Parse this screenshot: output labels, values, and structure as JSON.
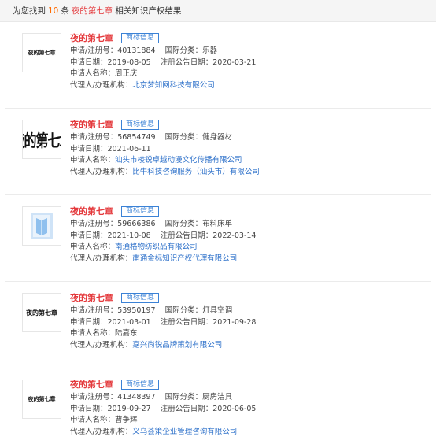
{
  "summary": {
    "prefix": "为您找到",
    "count": "10",
    "unit": "条",
    "keyword": "夜的第七章",
    "suffix": "相关知识产权结果"
  },
  "labels": {
    "reg_no": "申请/注册号：",
    "category": "国际分类：",
    "apply_date": "申请日期：",
    "announce_date": "注册公告日期：",
    "applicant": "申请人名称：",
    "agent": "代理人/办理机构："
  },
  "results": [
    {
      "logo_text": "夜的第七章",
      "logo_kind": "small-serif",
      "title": "夜的第七章",
      "tag": "商标信息",
      "reg_no": "40131884",
      "category": "乐器",
      "apply_date": "2019-08-05",
      "announce_date": "2020-03-21",
      "applicant": "周正庆",
      "applicant_link": false,
      "agent": "北京梦知网科技有限公司"
    },
    {
      "logo_text": "夜的第七章",
      "logo_kind": "big-bold",
      "title": "夜的第七章",
      "tag": "商标信息",
      "reg_no": "56854749",
      "category": "健身器材",
      "apply_date": "2021-06-11",
      "announce_date": "",
      "applicant": "汕头市棱锐卓越动漫文化传播有限公司",
      "applicant_link": true,
      "agent": "比牛科技咨询服务（汕头市）有限公司"
    },
    {
      "logo_text": "",
      "logo_kind": "book-icon",
      "title": "夜的第七章",
      "tag": "商标信息",
      "reg_no": "59666386",
      "category": "布料床单",
      "apply_date": "2021-10-08",
      "announce_date": "2022-03-14",
      "applicant": "南通格物纺织品有限公司",
      "applicant_link": true,
      "agent": "南通金标知识产权代理有限公司"
    },
    {
      "logo_text": "夜的第七章",
      "logo_kind": "med-bold",
      "title": "夜的第七章",
      "tag": "商标信息",
      "reg_no": "53950197",
      "category": "灯具空调",
      "apply_date": "2021-03-01",
      "announce_date": "2021-09-28",
      "applicant": "陆嘉东",
      "applicant_link": false,
      "agent": "嘉兴尚锐品牌策划有限公司"
    },
    {
      "logo_text": "夜的第七章",
      "logo_kind": "small-serif",
      "title": "夜的第七章",
      "tag": "商标信息",
      "reg_no": "41348397",
      "category": "厨房洁具",
      "apply_date": "2019-09-27",
      "announce_date": "2020-06-05",
      "applicant": "曹争辉",
      "applicant_link": false,
      "agent": "义乌荟策企业管理咨询有限公司"
    }
  ]
}
